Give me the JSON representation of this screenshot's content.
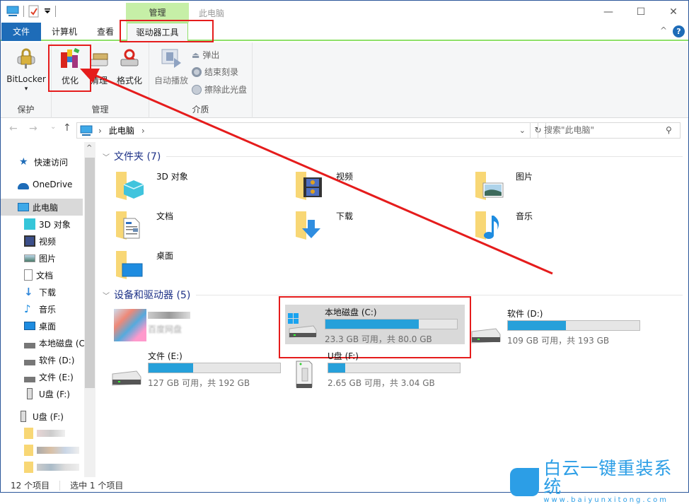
{
  "window": {
    "title": "此电脑",
    "context_tab_group": "管理",
    "controls": {
      "minimize": "—",
      "maximize": "☐",
      "close": "✕"
    }
  },
  "tabs": [
    {
      "label": "文件"
    },
    {
      "label": "计算机"
    },
    {
      "label": "查看"
    },
    {
      "label": "驱动器工具"
    }
  ],
  "ribbon": {
    "groups": [
      {
        "label": "保护",
        "buttons": [
          {
            "label": "BitLocker",
            "dropdown": "▾"
          }
        ]
      },
      {
        "label": "管理",
        "buttons": [
          {
            "label": "优化"
          },
          {
            "label": "清理"
          },
          {
            "label": "格式化"
          }
        ]
      },
      {
        "label": "介质",
        "buttons": [
          {
            "label": "自动播放"
          }
        ],
        "small_buttons": [
          {
            "label": "弹出"
          },
          {
            "label": "结束刻录"
          },
          {
            "label": "擦除此光盘"
          }
        ]
      }
    ],
    "collapse_icon": "^",
    "help_icon": "?"
  },
  "nav": {
    "back": "←",
    "forward": "→",
    "recent": "⌄",
    "up": "↑",
    "breadcrumb": [
      "此电脑"
    ],
    "separator": "›",
    "refresh": "↻",
    "search_placeholder": "搜索\"此电脑\""
  },
  "sidebar": {
    "items": [
      {
        "label": "快速访问",
        "icon": "star-icon"
      },
      {
        "label": "OneDrive",
        "icon": "cloud-icon"
      },
      {
        "label": "此电脑",
        "icon": "computer-icon",
        "selected": true
      },
      {
        "label": "3D 对象",
        "icon": "cube-icon"
      },
      {
        "label": "视频",
        "icon": "video-icon"
      },
      {
        "label": "图片",
        "icon": "picture-icon"
      },
      {
        "label": "文档",
        "icon": "document-icon"
      },
      {
        "label": "下载",
        "icon": "download-icon"
      },
      {
        "label": "音乐",
        "icon": "music-icon"
      },
      {
        "label": "桌面",
        "icon": "desktop-icon"
      },
      {
        "label": "本地磁盘 (C:)",
        "icon": "windows-drive-icon"
      },
      {
        "label": "软件 (D:)",
        "icon": "drive-icon"
      },
      {
        "label": "文件 (E:)",
        "icon": "drive-icon"
      },
      {
        "label": "U盘 (F:)",
        "icon": "usb-drive-icon"
      },
      {
        "label": "U盘 (F:)",
        "icon": "usb-drive-icon"
      }
    ]
  },
  "main": {
    "folders_header": "文件夹 (7)",
    "folders": [
      {
        "label": "3D 对象"
      },
      {
        "label": "视频"
      },
      {
        "label": "图片"
      },
      {
        "label": "文档"
      },
      {
        "label": "下载"
      },
      {
        "label": "音乐"
      },
      {
        "label": "桌面"
      }
    ],
    "drives_header": "设备和驱动器 (5)",
    "drives": [
      {
        "name": "本地磁盘 (C:)",
        "space": "23.3 GB 可用，共 80.0 GB",
        "used_fraction": 0.71,
        "selected": true
      },
      {
        "name": "软件 (D:)",
        "space": "109 GB 可用，共 193 GB",
        "used_fraction": 0.44
      },
      {
        "name": "文件 (E:)",
        "space": "127 GB 可用，共 192 GB",
        "used_fraction": 0.34
      },
      {
        "name": "U盘 (F:)",
        "space": "2.65 GB 可用，共 3.04 GB",
        "used_fraction": 0.13
      }
    ],
    "cloud_drive_label": "百度网盘"
  },
  "status": {
    "item_count": "12 个项目",
    "selected_count": "选中 1 个项目"
  },
  "watermark": {
    "title": "白云一键重装系统",
    "url": "www.baiyunxitong.com"
  },
  "colors": {
    "accent": "#1e6cb8",
    "context_tab": "#c6efa7",
    "bar_fill": "#26a0da",
    "annotation": "#e51c1c"
  }
}
